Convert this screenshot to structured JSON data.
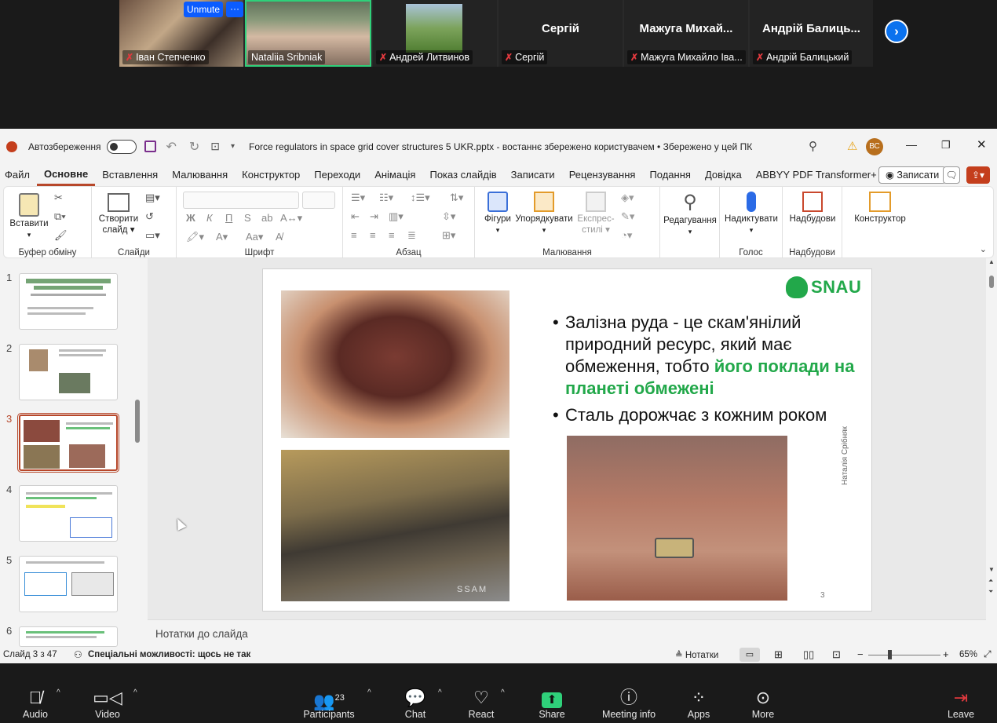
{
  "gallery": {
    "unmute_label": "Unmute",
    "more_label": "···",
    "participants": [
      {
        "name": "Іван Степченко",
        "muted": true
      },
      {
        "name": "Nataliia Sribniak",
        "muted": false
      },
      {
        "name": "Андрей Литвинов",
        "muted": true
      },
      {
        "name": "Сергій",
        "display": "Сергій",
        "muted": true
      },
      {
        "name": "Мажуга Михайло Іва...",
        "display": "Мажуга  Михай...",
        "muted": true
      },
      {
        "name": "Андрій Балицький",
        "display": "Андрій  Балиць...",
        "muted": true
      }
    ],
    "next_icon": "chevron-right-icon"
  },
  "ppt": {
    "autosave_label": "Автозбереження",
    "doc_title": "Force regulators in space grid cover structures 5 UKR.pptx  -  востаннє збережено користувачем  •  Збережено у цей ПК",
    "user_initials": "ВС",
    "menu": [
      "Файл",
      "Основне",
      "Вставлення",
      "Малювання",
      "Конструктор",
      "Переходи",
      "Анімація",
      "Показ слайдів",
      "Записати",
      "Рецензування",
      "Подання",
      "Довідка",
      "ABBYY PDF Transformer+"
    ],
    "record_label": "Записати",
    "ribbon": {
      "paste": "Вставити",
      "clipboard": "Буфер обміну",
      "new_slide_1": "Створити",
      "new_slide_2": "слайд",
      "slides": "Слайди",
      "font_group": "Шрифт",
      "bold": "Ж",
      "italic": "К",
      "underline": "П",
      "strike": "S",
      "paragraph": "Абзац",
      "shapes": "Фігури",
      "arrange": "Упорядкувати",
      "quick_styles_1": "Експрес-",
      "quick_styles_2": "стилі",
      "drawing": "Малювання",
      "editing": "Редагування",
      "dictate": "Надиктувати",
      "voice": "Голос",
      "addins": "Надбудови",
      "addins_group": "Надбудови",
      "designer": "Конструктор"
    },
    "thumb_numbers": [
      "1",
      "2",
      "3",
      "4",
      "5",
      "6"
    ],
    "slide": {
      "logo": "SNAU",
      "bullet1_plain": "Залізна руда - це скам'янілий природний ресурс, який має обмеження, тобто ",
      "bullet1_green": "його поклади на планеті обмежені",
      "bullet2": "Сталь дорожчає з кожним роком",
      "side_text": "Наталія Срібняк",
      "page_num": "3",
      "watermark": "SSAM"
    },
    "notes_placeholder": "Нотатки до слайда",
    "status": {
      "slide_info": "Слайд 3 з 47",
      "accessibility": "Спеціальні можливості: щось не так",
      "notes": "Нотатки",
      "zoom": "65%"
    }
  },
  "zoom_toolbar": {
    "audio": "Audio",
    "video": "Video",
    "participants": "Participants",
    "participants_count": "23",
    "chat": "Chat",
    "react": "React",
    "share": "Share",
    "meeting_info": "Meeting info",
    "apps": "Apps",
    "more": "More",
    "leave": "Leave"
  },
  "colors": {
    "zoom_blue": "#0b5cff",
    "ppt_accent": "#b7472a",
    "slide_green": "#22a84a",
    "share_green": "#2fd07a"
  }
}
